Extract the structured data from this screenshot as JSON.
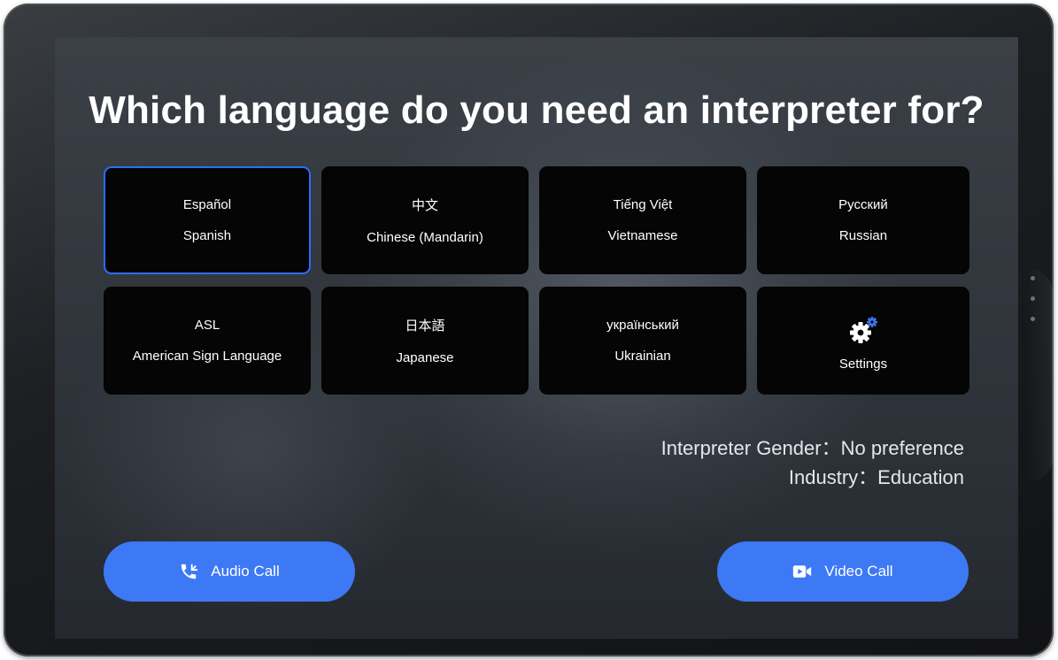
{
  "title": "Which language do you need an interpreter for?",
  "languages": [
    {
      "native": "Español",
      "english": "Spanish",
      "selected": true
    },
    {
      "native": "中文",
      "english": "Chinese (Mandarin)",
      "selected": false
    },
    {
      "native": "Tiếng Việt",
      "english": "Vietnamese",
      "selected": false
    },
    {
      "native": "Русский",
      "english": "Russian",
      "selected": false
    },
    {
      "native": "ASL",
      "english": "American Sign Language",
      "selected": false
    },
    {
      "native": "日本語",
      "english": "Japanese",
      "selected": false
    },
    {
      "native": "український",
      "english": "Ukrainian",
      "selected": false
    }
  ],
  "settings": {
    "label": "Settings",
    "icon": "gear-icon"
  },
  "preferences": {
    "gender_line": "Interpreter Gender：No preference",
    "industry_line": "Industry：Education"
  },
  "buttons": {
    "audio_label": "Audio Call",
    "video_label": "Video Call"
  },
  "colors": {
    "accent": "#3d78f5",
    "selected_border": "#2f6bff",
    "tile_bg": "#050505"
  }
}
